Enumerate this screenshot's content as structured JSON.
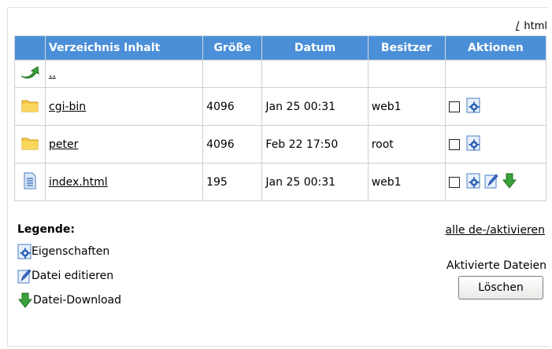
{
  "path": {
    "separator": "/",
    "current": "html"
  },
  "table": {
    "headers": {
      "name": "Verzeichnis Inhalt",
      "size": "Größe",
      "date": "Datum",
      "owner": "Besitzer",
      "actions": "Aktionen"
    },
    "updir": {
      "label": ".."
    },
    "rows": [
      {
        "name": "cgi-bin",
        "size": "4096",
        "date": "Jan 25 00:31",
        "owner": "web1",
        "type": "folder",
        "actions": [
          "properties"
        ]
      },
      {
        "name": "peter",
        "size": "4096",
        "date": "Feb 22 17:50",
        "owner": "root",
        "type": "folder",
        "actions": [
          "properties"
        ]
      },
      {
        "name": "index.html",
        "size": "195",
        "date": "Jan 25 00:31",
        "owner": "web1",
        "type": "file",
        "actions": [
          "properties",
          "edit",
          "download"
        ]
      }
    ]
  },
  "legend": {
    "title": "Legende:",
    "items": [
      {
        "icon": "properties-icon",
        "label": "Eigenschaften"
      },
      {
        "icon": "edit-icon",
        "label": "Datei editieren"
      },
      {
        "icon": "download-icon",
        "label": "Datei-Download"
      }
    ]
  },
  "toggle_all": "alle de-/aktivieren",
  "activated_label": "Aktivierte Dateien",
  "delete_button": "Löschen",
  "colors": {
    "header": "#4b8fd8",
    "folder": "#f7c948",
    "updir_arrow": "#3aa13a"
  }
}
